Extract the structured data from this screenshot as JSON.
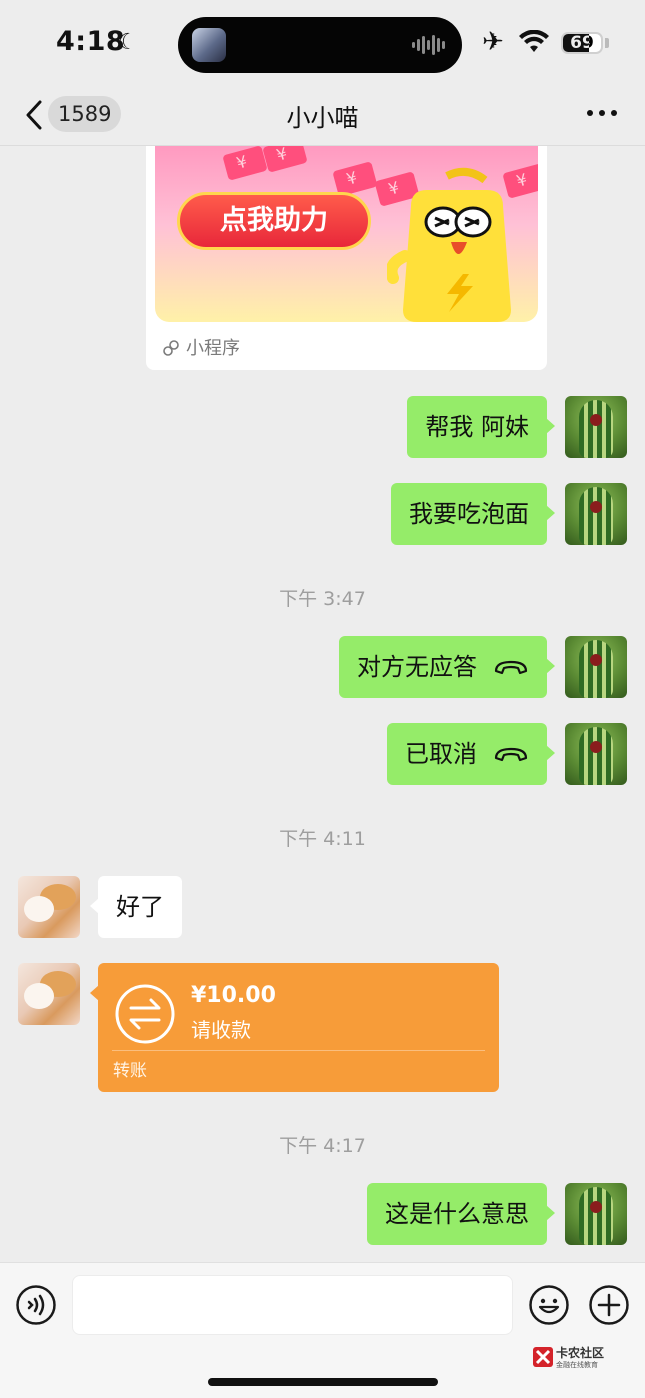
{
  "status_bar": {
    "time": "4:18",
    "battery": "69",
    "icons": [
      "moon-icon",
      "airplane-icon",
      "wifi-icon",
      "battery-icon"
    ]
  },
  "nav": {
    "unread_count": "1589",
    "title": "小小喵",
    "icons": [
      "back-icon",
      "more-icon"
    ]
  },
  "mini_program": {
    "button_text": "点我助力",
    "footer_label": "小程序"
  },
  "messages": [
    {
      "side": "me",
      "text": "帮我 阿妹"
    },
    {
      "side": "me",
      "text": "我要吃泡面"
    },
    {
      "type": "time",
      "text": "下午 3:47"
    },
    {
      "side": "me",
      "text": "对方无应答",
      "icon": "call-icon"
    },
    {
      "side": "me",
      "text": "已取消",
      "icon": "call-icon"
    },
    {
      "type": "time",
      "text": "下午 4:11"
    },
    {
      "side": "other",
      "text": "好了"
    },
    {
      "side": "other",
      "type": "transfer",
      "amount": "¥10.00",
      "status": "请收款",
      "label": "转账"
    },
    {
      "type": "time",
      "text": "下午 4:17"
    },
    {
      "side": "me",
      "text": "这是什么意思"
    }
  ],
  "input_bar": {
    "placeholder": "",
    "icons": [
      "voice-icon",
      "emoji-icon",
      "plus-icon"
    ]
  },
  "watermark": {
    "title": "卡农社区",
    "subtitle": "金融在线教育"
  },
  "colors": {
    "background": "#ededed",
    "my_bubble": "#95ec69",
    "other_bubble": "#ffffff",
    "transfer": "#f79c39"
  }
}
